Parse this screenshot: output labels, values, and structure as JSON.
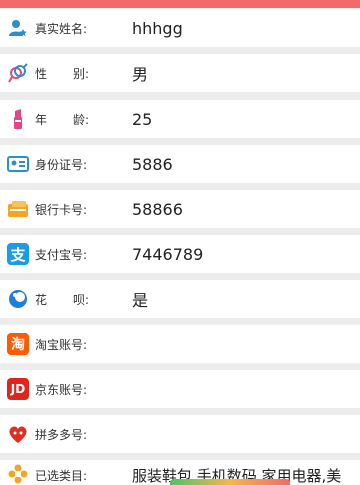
{
  "fields": [
    {
      "label": "真实姓名:",
      "value": "hhhgg"
    },
    {
      "label_a": "性",
      "label_b": "别:",
      "value": "男"
    },
    {
      "label_a": "年",
      "label_b": "龄:",
      "value": "25"
    },
    {
      "label": "身份证号:",
      "value": "5886"
    },
    {
      "label": "银行卡号:",
      "value": "58866"
    },
    {
      "label": "支付宝号:",
      "value": "7446789"
    },
    {
      "label_a": "花",
      "label_b": "呗:",
      "value": "是"
    },
    {
      "label": "淘宝账号:",
      "value": ""
    },
    {
      "label": "京东账号:",
      "value": ""
    },
    {
      "label": "拼多多号:",
      "value": ""
    },
    {
      "label": "已选类目:",
      "value": "服装鞋包,手机数码,家用电器,美"
    }
  ],
  "icons": {
    "alipay_glyph": "支",
    "taobao_glyph": "淘",
    "jd_glyph": "JD"
  },
  "colors": {
    "top_bar": "#f26a6a"
  }
}
